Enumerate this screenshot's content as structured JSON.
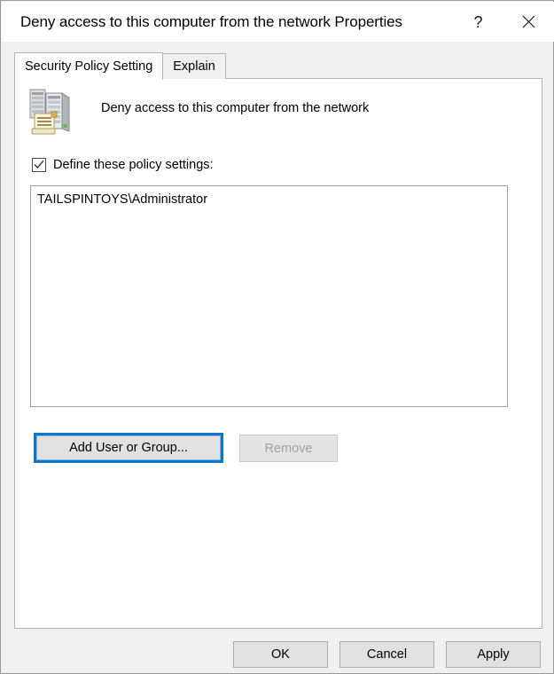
{
  "window": {
    "title": "Deny access to this computer from the network Properties",
    "help_button": "?",
    "help_icon": "question-mark-icon",
    "close_icon": "close-x-icon"
  },
  "tabs": [
    {
      "label": "Security Policy Setting",
      "active": true
    },
    {
      "label": "Explain",
      "active": false
    }
  ],
  "policy": {
    "icon": "security-policy-server-icon",
    "name": "Deny access to this computer from the network"
  },
  "define_checkbox": {
    "label": "Define these policy settings:",
    "checked": true,
    "check_icon": "checkmark-icon"
  },
  "list": {
    "items": [
      "TAILSPINTOYS\\Administrator"
    ]
  },
  "actions": {
    "add_user_or_group": "Add User or Group...",
    "add_user_focused": true,
    "remove": "Remove",
    "remove_enabled": false
  },
  "footer": {
    "ok": "OK",
    "cancel": "Cancel",
    "apply": "Apply"
  },
  "colors": {
    "focus_blue": "#0078d7",
    "dialog_background": "#f0f0f0",
    "panel_background": "#ffffff",
    "button_face": "#e1e1e1",
    "disabled_text": "#a0a0a0"
  }
}
